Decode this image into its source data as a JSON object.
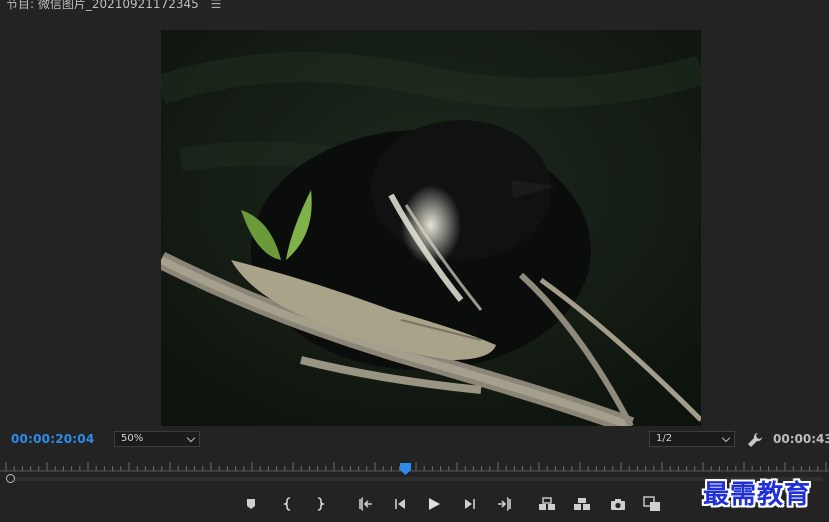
{
  "header": {
    "title": "节目: 微信图片_20210921172345",
    "menu_icon": "hamburger-menu-icon"
  },
  "viewer": {
    "image_description_icon": "program-monitor-frame"
  },
  "status_bar": {
    "current_timecode": "00:00:20:04",
    "zoom_level": "50%",
    "resolution": "1/2",
    "settings_icon": "wrench-icon",
    "duration_timecode": "00:00:43"
  },
  "timeline": {
    "playhead_fraction": 0.49
  },
  "transport": {
    "buttons": [
      "add-marker-icon",
      "mark-in-icon",
      "mark-out-icon",
      "go-to-in-icon",
      "step-back-icon",
      "play-icon",
      "step-forward-icon",
      "go-to-out-icon",
      "lift-icon",
      "extract-icon",
      "export-frame-icon",
      "compare-view-icon"
    ]
  },
  "watermark": {
    "text": "最需教育"
  },
  "colors": {
    "timecode_blue": "#2d8ceb",
    "background": "#232323",
    "watermark_blue": "#1f30d8"
  }
}
